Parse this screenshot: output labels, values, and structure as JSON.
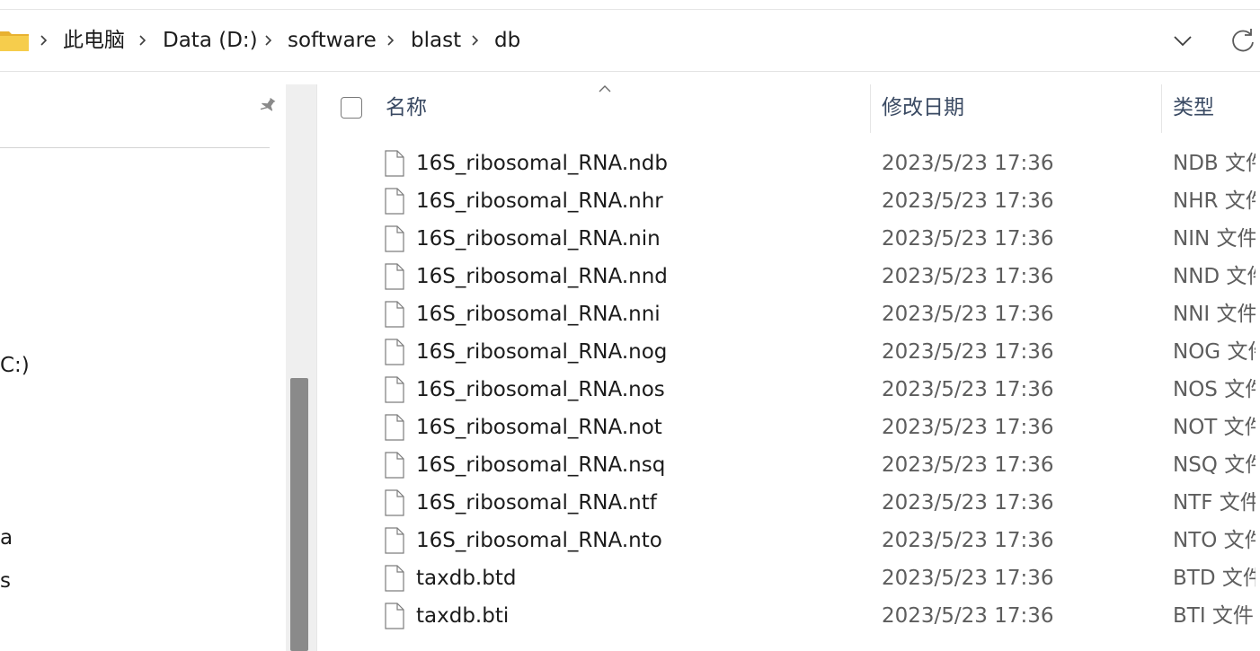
{
  "address_bar": {
    "breadcrumb": [
      {
        "label": "此电脑"
      },
      {
        "label": "Data (D:)"
      },
      {
        "label": "software"
      },
      {
        "label": "blast"
      },
      {
        "label": "db"
      }
    ]
  },
  "nav_pane": {
    "items": [
      {
        "label": "C:)"
      },
      {
        "label": "a"
      },
      {
        "label": "s"
      }
    ]
  },
  "columns": {
    "name": "名称",
    "modified": "修改日期",
    "type": "类型"
  },
  "files": [
    {
      "name": "16S_ribosomal_RNA.ndb",
      "modified": "2023/5/23 17:36",
      "type": "NDB 文件"
    },
    {
      "name": "16S_ribosomal_RNA.nhr",
      "modified": "2023/5/23 17:36",
      "type": "NHR 文件"
    },
    {
      "name": "16S_ribosomal_RNA.nin",
      "modified": "2023/5/23 17:36",
      "type": "NIN 文件"
    },
    {
      "name": "16S_ribosomal_RNA.nnd",
      "modified": "2023/5/23 17:36",
      "type": "NND 文件"
    },
    {
      "name": "16S_ribosomal_RNA.nni",
      "modified": "2023/5/23 17:36",
      "type": "NNI 文件"
    },
    {
      "name": "16S_ribosomal_RNA.nog",
      "modified": "2023/5/23 17:36",
      "type": "NOG 文件"
    },
    {
      "name": "16S_ribosomal_RNA.nos",
      "modified": "2023/5/23 17:36",
      "type": "NOS 文件"
    },
    {
      "name": "16S_ribosomal_RNA.not",
      "modified": "2023/5/23 17:36",
      "type": "NOT 文件"
    },
    {
      "name": "16S_ribosomal_RNA.nsq",
      "modified": "2023/5/23 17:36",
      "type": "NSQ 文件"
    },
    {
      "name": "16S_ribosomal_RNA.ntf",
      "modified": "2023/5/23 17:36",
      "type": "NTF 文件"
    },
    {
      "name": "16S_ribosomal_RNA.nto",
      "modified": "2023/5/23 17:36",
      "type": "NTO 文件"
    },
    {
      "name": "taxdb.btd",
      "modified": "2023/5/23 17:36",
      "type": "BTD 文件"
    },
    {
      "name": "taxdb.bti",
      "modified": "2023/5/23 17:36",
      "type": "BTI 文件"
    }
  ],
  "icons": {
    "folder": "folder-icon",
    "separator": "chevron-right-icon",
    "dropdown": "chevron-down-icon",
    "refresh": "refresh-icon",
    "pin": "pin-icon",
    "file": "file-icon",
    "sort": "sort-caret-icon"
  },
  "colors": {
    "folder": "#f4c542",
    "header_text": "#3a4a63",
    "scrollbar_thumb": "#8a8a8a"
  }
}
